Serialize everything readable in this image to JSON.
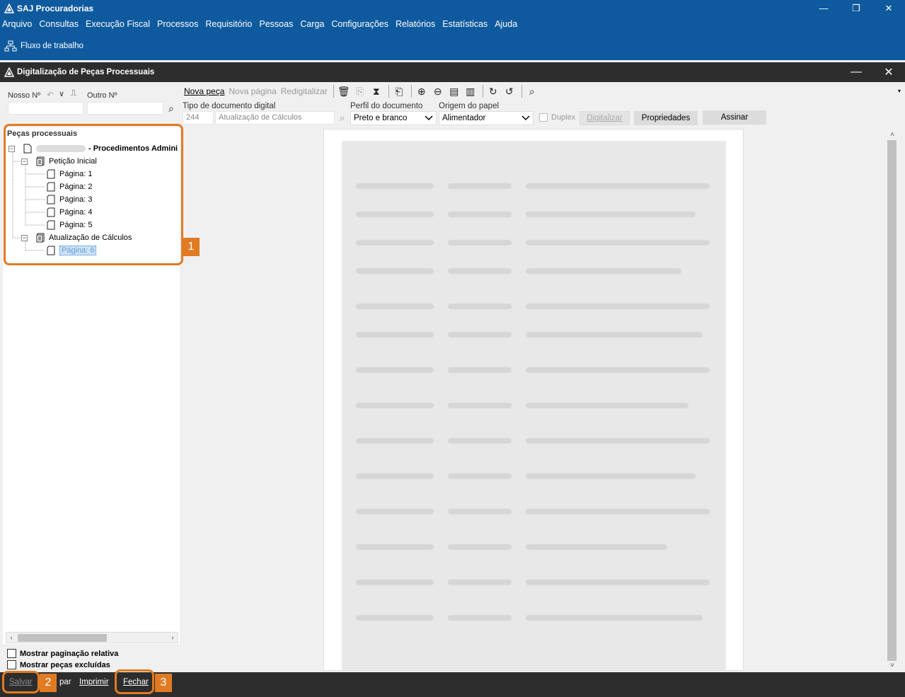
{
  "app": {
    "title": "SAJ Procuradorias",
    "minimize": "—",
    "restore": "❐",
    "close": "✕"
  },
  "menu": [
    "Arquivo",
    "Consultas",
    "Execução Fiscal",
    "Processos",
    "Requisitório",
    "Pessoas",
    "Carga",
    "Configurações",
    "Relatórios",
    "Estatísticas",
    "Ajuda"
  ],
  "ribbon": {
    "workflow_label": "Fluxo de trabalho"
  },
  "child_window": {
    "title": "Digitalização de Peças Processuais",
    "minimize": "—",
    "close": "✕"
  },
  "search": {
    "nosso_label": "Nosso Nº",
    "outro_label": "Outro Nº",
    "nosso_value": "",
    "outro_value": ""
  },
  "tree": {
    "header": "Peças processuais",
    "root_label": "- Procedimentos Admini",
    "children": [
      {
        "label": "Petição Inicial",
        "pages": [
          "Página: 1",
          "Página: 2",
          "Página: 3",
          "Página: 4",
          "Página: 5"
        ]
      },
      {
        "label": "Atualização de Cálculos",
        "pages": [
          "Página: 6"
        ]
      }
    ]
  },
  "options": {
    "relative_paging": "Mostrar paginação relativa",
    "show_deleted": "Mostrar peças excluídas"
  },
  "toolbar": {
    "nova_peca": "Nova peça",
    "nova_pagina": "Nova página",
    "redigitalizar": "Redigitalizar"
  },
  "form": {
    "tipo_label": "Tipo de documento digital",
    "tipo_code": "244",
    "tipo_value": "Atualização de Cálculos",
    "perfil_label": "Perfil do documento",
    "perfil_value": "Preto e branco",
    "origem_label": "Origem do papel",
    "origem_value": "Alimentador",
    "duplex_label": "Duplex",
    "digitalizar": "Digitalizar",
    "propriedades": "Propriedades",
    "assinar": "Assinar"
  },
  "bottom": {
    "salvar": "Salvar",
    "limpar": "par",
    "imprimir": "Imprimir",
    "fechar": "Fechar"
  },
  "callouts": [
    "1",
    "2",
    "3"
  ],
  "colors": {
    "brand_blue": "#0f5a9e",
    "dark_bar": "#2d2d2d",
    "callout": "#e07b24"
  }
}
